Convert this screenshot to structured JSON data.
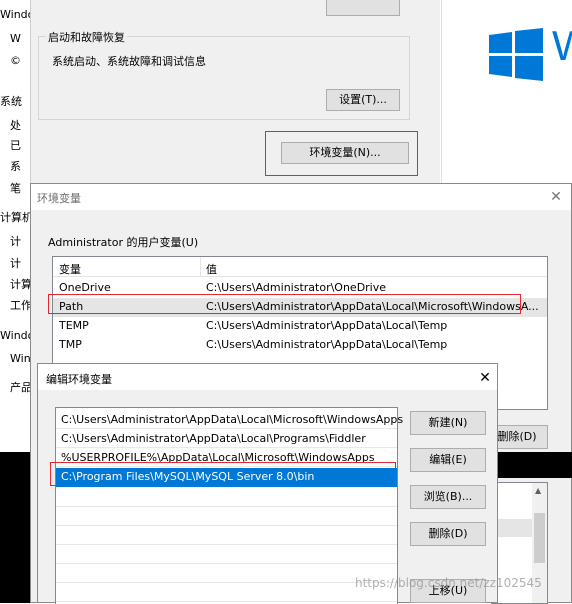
{
  "sysprops": {
    "left_edge_items": [
      "Windo",
      "W",
      "©",
      "系统",
      "处",
      "已",
      "系",
      "笔",
      "计算机",
      "计",
      "计",
      "计算",
      "工作",
      "Windo",
      "Win",
      "产品"
    ],
    "recovery_group_title": "启动和故障恢复",
    "recovery_desc": "系统启动、系统故障和调试信息",
    "settings_button": "设置(T)...",
    "env_vars_button": "环境变量(N)..."
  },
  "env_dialog": {
    "title": "环境变量",
    "user_vars_label": "Administrator 的用户变量(U)",
    "columns": [
      "变量",
      "值"
    ],
    "rows": [
      {
        "name": "OneDrive",
        "value": "C:\\Users\\Administrator\\OneDrive"
      },
      {
        "name": "Path",
        "value": "C:\\Users\\Administrator\\AppData\\Local\\Microsoft\\WindowsA..."
      },
      {
        "name": "TEMP",
        "value": "C:\\Users\\Administrator\\AppData\\Local\\Temp"
      },
      {
        "name": "TMP",
        "value": "C:\\Users\\Administrator\\AppData\\Local\\Temp"
      }
    ],
    "partial_delete_button": "删除(D)"
  },
  "edit_dialog": {
    "title": "编辑环境变量",
    "paths": [
      "C:\\Users\\Administrator\\AppData\\Local\\Microsoft\\WindowsApps",
      "C:\\Users\\Administrator\\AppData\\Local\\Programs\\Fiddler",
      "%USERPROFILE%\\AppData\\Local\\Microsoft\\WindowsApps",
      "C:\\Program Files\\MySQL\\MySQL Server 8.0\\bin"
    ],
    "selected_index": 3,
    "buttons": {
      "new": "新建(N)",
      "edit": "编辑(E)",
      "browse": "浏览(B)...",
      "delete": "删除(D)",
      "move_up": "上移(U)"
    }
  },
  "watermark": "https://blog.csdn.net/zz102545",
  "colors": {
    "selection": "#0078d7",
    "annotation_red": "#e8262d",
    "windows_blue": "#0078d7"
  }
}
